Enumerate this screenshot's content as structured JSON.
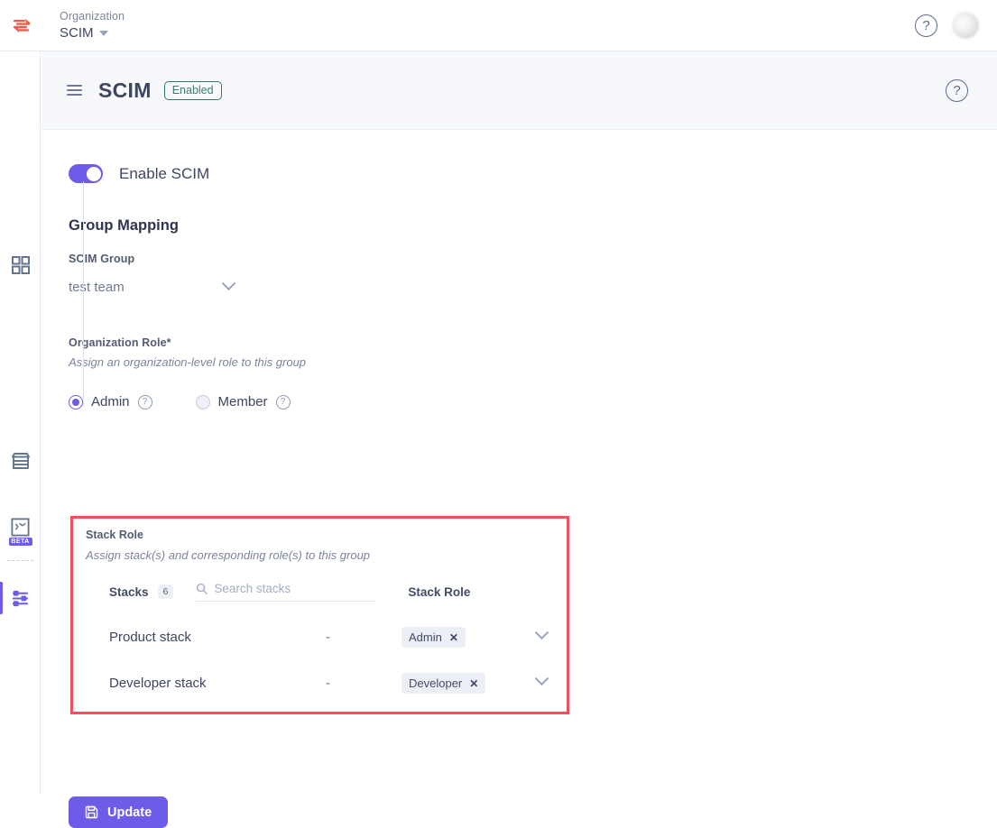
{
  "topbar": {
    "org_label": "Organization",
    "org_name": "SCIM",
    "help_icon": "question-circle-icon",
    "avatar": "user-avatar"
  },
  "sidebar": {
    "items": [
      {
        "icon": "grid-dashboard-icon",
        "active": false
      },
      {
        "icon": "store-marketplace-icon",
        "active": false
      },
      {
        "icon": "puzzle-integrations-icon",
        "active": false,
        "badge": "BETA"
      },
      {
        "icon": "sliders-settings-icon",
        "active": true
      }
    ]
  },
  "page_header": {
    "menu_icon": "hamburger-menu-icon",
    "title": "SCIM",
    "status_badge": "Enabled",
    "help_icon": "question-circle-icon"
  },
  "main": {
    "enable_toggle": {
      "label": "Enable SCIM",
      "state": "on"
    },
    "group_mapping": {
      "heading": "Group Mapping",
      "scim_group": {
        "label": "SCIM Group",
        "value": "test team",
        "chevron": "chevron-down-icon"
      }
    },
    "organization_role": {
      "label": "Organization Role*",
      "hint": "Assign an organization-level role to this group",
      "options": [
        {
          "label": "Admin",
          "selected": true,
          "help_icon": "question-circle-icon"
        },
        {
          "label": "Member",
          "selected": false,
          "help_icon": "question-circle-icon"
        }
      ]
    },
    "stack_role": {
      "label": "Stack Role",
      "hint": "Assign stack(s) and corresponding role(s) to this group",
      "highlighted": true,
      "highlight_color": "#f14f5c",
      "table": {
        "col_stacks": "Stacks",
        "stacks_count": "6",
        "col_role": "Stack Role",
        "search_placeholder": "Search stacks",
        "search_value": "",
        "search_icon": "search-icon",
        "rows": [
          {
            "name": "Product stack",
            "middle": "-",
            "role": "Admin",
            "remove_icon": "close-icon",
            "chevron": "chevron-down-icon"
          },
          {
            "name": "Developer stack",
            "middle": "-",
            "role": "Developer",
            "remove_icon": "close-icon",
            "chevron": "chevron-down-icon"
          }
        ]
      }
    },
    "update_button": {
      "label": "Update",
      "icon": "save-disk-icon"
    }
  },
  "colors": {
    "accent": "#6c5ce7",
    "highlight": "#f14f5c",
    "enabled_badge": "#2e7d5b",
    "text": "#3d4561"
  }
}
